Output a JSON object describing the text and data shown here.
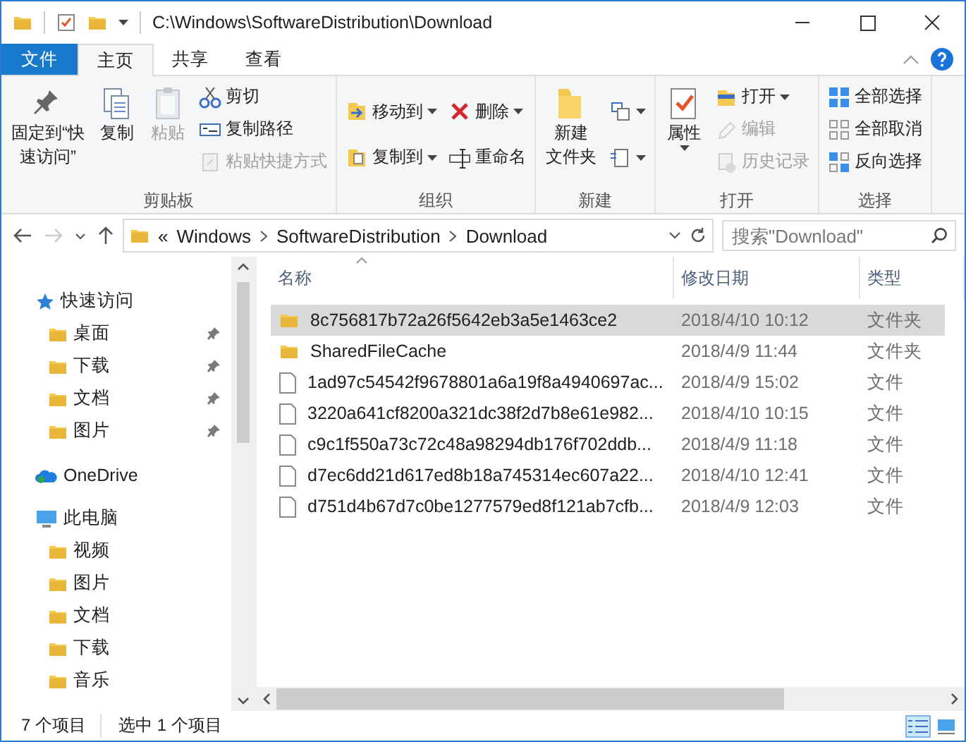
{
  "window": {
    "title": "C:\\Windows\\SoftwareDistribution\\Download"
  },
  "tabs": [
    {
      "label": "文件",
      "kind": "file",
      "selected": false
    },
    {
      "label": "主页",
      "kind": "tab",
      "selected": true
    },
    {
      "label": "共享",
      "kind": "tab",
      "selected": false
    },
    {
      "label": "查看",
      "kind": "tab",
      "selected": false
    }
  ],
  "ribbon": {
    "groups": [
      {
        "label": "剪贴板",
        "columns": [
          [
            {
              "kind": "large",
              "label": [
                "固定到“快",
                "速访问”"
              ],
              "disabled": false,
              "dropdown": false
            }
          ],
          [
            {
              "kind": "large",
              "label": [
                "复制"
              ],
              "disabled": false,
              "dropdown": false
            }
          ],
          [
            {
              "kind": "large",
              "label": [
                "粘贴"
              ],
              "disabled": true,
              "dropdown": false
            }
          ],
          [
            {
              "kind": "small",
              "label": "剪切",
              "disabled": false,
              "dropdown": false
            },
            {
              "kind": "small",
              "label": "复制路径",
              "disabled": false,
              "dropdown": false
            },
            {
              "kind": "small",
              "label": "粘贴快捷方式",
              "disabled": true,
              "dropdown": false
            }
          ]
        ]
      },
      {
        "label": "组织",
        "columns": [
          [
            {
              "kind": "small",
              "label": "移动到",
              "disabled": false,
              "dropdown": true
            },
            {
              "kind": "small",
              "label": "复制到",
              "disabled": false,
              "dropdown": true
            }
          ],
          [
            {
              "kind": "small",
              "label": "删除",
              "disabled": false,
              "dropdown": true
            },
            {
              "kind": "small",
              "label": "重命名",
              "disabled": false,
              "dropdown": false
            }
          ]
        ]
      },
      {
        "label": "新建",
        "columns": [
          [
            {
              "kind": "large",
              "label": [
                "新建",
                "文件夹"
              ],
              "disabled": false,
              "dropdown": false
            }
          ],
          [
            {
              "kind": "small",
              "disabled": false,
              "dropdown": true
            },
            {
              "kind": "small",
              "disabled": false,
              "dropdown": true
            }
          ]
        ]
      },
      {
        "label": "打开",
        "columns": [
          [
            {
              "kind": "large",
              "label": [
                "属性"
              ],
              "disabled": false,
              "dropdown": true
            }
          ],
          [
            {
              "kind": "small",
              "label": "打开",
              "disabled": false,
              "dropdown": true
            },
            {
              "kind": "small",
              "label": "编辑",
              "disabled": true,
              "dropdown": false
            },
            {
              "kind": "small",
              "label": "历史记录",
              "disabled": true,
              "dropdown": false
            }
          ]
        ]
      },
      {
        "label": "选择",
        "columns": [
          [
            {
              "kind": "small",
              "label": "全部选择",
              "disabled": false,
              "dropdown": false
            },
            {
              "kind": "small",
              "label": "全部取消",
              "disabled": false,
              "dropdown": false
            },
            {
              "kind": "small",
              "label": "反向选择",
              "disabled": false,
              "dropdown": false
            }
          ]
        ]
      }
    ]
  },
  "address": {
    "overflow": "«",
    "crumbs": [
      "Windows",
      "SoftwareDistribution",
      "Download"
    ],
    "search": {
      "placeholder": "搜索\"Download\""
    }
  },
  "sidebar": {
    "items": [
      {
        "label": "快速访问",
        "kind": "star",
        "children": [
          {
            "label": "桌面",
            "kind": "folder",
            "pinned": true
          },
          {
            "label": "下载",
            "kind": "folder",
            "pinned": true
          },
          {
            "label": "文档",
            "kind": "folder",
            "pinned": true
          },
          {
            "label": "图片",
            "kind": "folder",
            "pinned": true
          }
        ]
      },
      {
        "label": "OneDrive",
        "kind": "cloud"
      },
      {
        "label": "此电脑",
        "kind": "pc",
        "children": [
          {
            "label": "视频",
            "kind": "folder",
            "pinned": false
          },
          {
            "label": "图片",
            "kind": "folder",
            "pinned": false
          },
          {
            "label": "文档",
            "kind": "folder",
            "pinned": false
          },
          {
            "label": "下载",
            "kind": "folder",
            "pinned": false
          },
          {
            "label": "音乐",
            "kind": "folder",
            "pinned": false
          }
        ]
      }
    ]
  },
  "table": {
    "columns": [
      "名称",
      "修改日期",
      "类型"
    ],
    "rows": [
      {
        "name": "8c756817b72a26f5642eb3a5e1463ce2",
        "date": "2018/4/10 10:12",
        "type": "文件夹",
        "kind": "folder",
        "selected": true
      },
      {
        "name": "SharedFileCache",
        "date": "2018/4/9 11:44",
        "type": "文件夹",
        "kind": "folder",
        "selected": false
      },
      {
        "name": "1ad97c54542f9678801a6a19f8a4940697ac...",
        "date": "2018/4/9 15:02",
        "type": "文件",
        "kind": "file",
        "selected": false
      },
      {
        "name": "3220a641cf8200a321dc38f2d7b8e61e982...",
        "date": "2018/4/10 10:15",
        "type": "文件",
        "kind": "file",
        "selected": false
      },
      {
        "name": "c9c1f550a73c72c48a98294db176f702ddb...",
        "date": "2018/4/9 11:18",
        "type": "文件",
        "kind": "file",
        "selected": false
      },
      {
        "name": "d7ec6dd21d617ed8b18a745314ec607a22...",
        "date": "2018/4/10 12:41",
        "type": "文件",
        "kind": "file",
        "selected": false
      },
      {
        "name": "d751d4b67d7c0be1277579ed8f121ab7cfb...",
        "date": "2018/4/9 12:03",
        "type": "文件",
        "kind": "file",
        "selected": false
      }
    ]
  },
  "status_bar": {
    "count": "7 个项目",
    "selection": "选中 1 个项目",
    "views": [
      {
        "kind": "details",
        "selected": true
      },
      {
        "kind": "large",
        "selected": false
      }
    ]
  }
}
